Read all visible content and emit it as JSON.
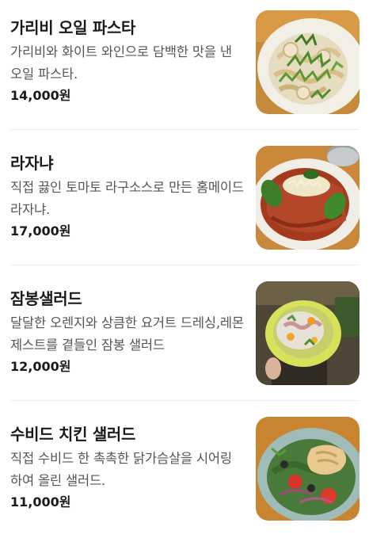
{
  "menu": {
    "items": [
      {
        "name": "가리비 오일 파스타",
        "description": "가리비와 화이트 와인으로 담백한 맛을 낸 오일 파스타.",
        "price": "14,000원"
      },
      {
        "name": "라자냐",
        "description": "직접 끓인 토마토 라구소스로 만든 홈메이드 라자냐.",
        "price": "17,000원"
      },
      {
        "name": "잠봉샐러드",
        "description": "달달한 오렌지와 상큼한 요거트 드레싱,레몬 제스트를 곁들인 잠봉 샐러드",
        "price": "12,000원"
      },
      {
        "name": "수비드 치킨 샐러드",
        "description": "직접 수비드 한 촉촉한 닭가슴살을 시어링 하여 올린 샐러드.",
        "price": "11,000원"
      }
    ]
  }
}
